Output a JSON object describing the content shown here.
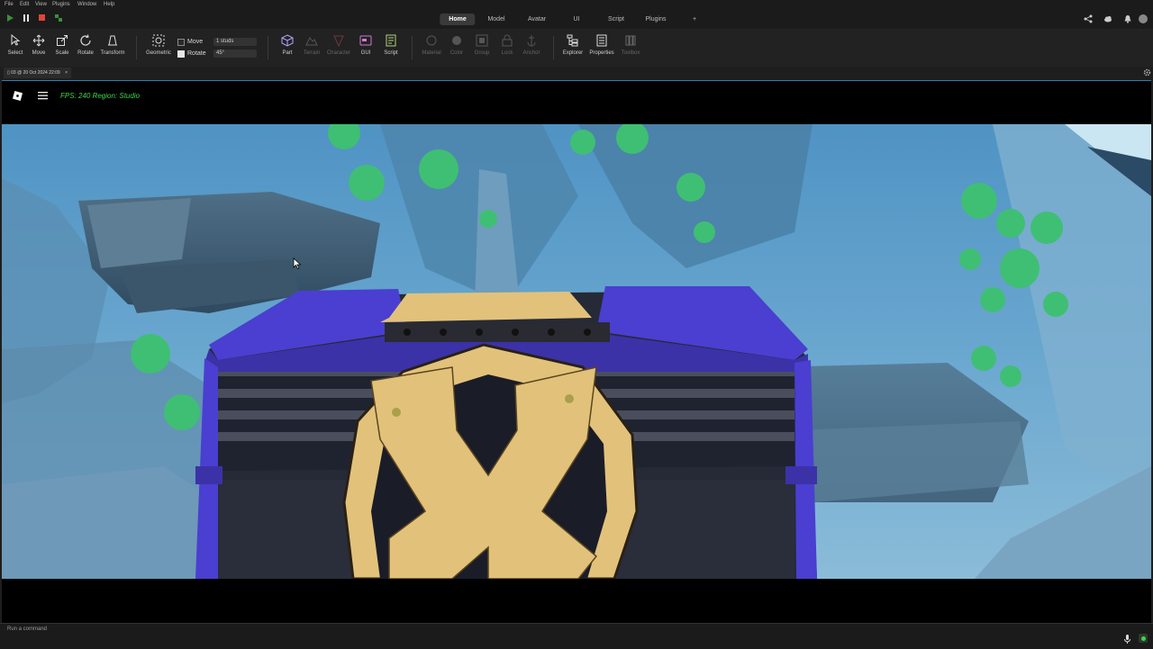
{
  "menu": [
    "File",
    "Edit",
    "View",
    "Plugins",
    "Window",
    "Help"
  ],
  "tabs": [
    {
      "label": "Home",
      "active": true
    },
    {
      "label": "Model",
      "active": false
    },
    {
      "label": "Avatar",
      "active": false
    },
    {
      "label": "UI",
      "active": false
    },
    {
      "label": "Script",
      "active": false
    },
    {
      "label": "Plugins",
      "active": false
    },
    {
      "label": "+",
      "active": false
    }
  ],
  "tools": {
    "select": "Select",
    "move": "Move",
    "scale": "Scale",
    "rotate": "Rotate",
    "transform": "Transform",
    "geometric": "Geometric"
  },
  "snap": {
    "move_label": "Move",
    "move_checked": false,
    "move_value": "1 studs",
    "rotate_label": "Rotate",
    "rotate_checked": true,
    "rotate_value": "45°"
  },
  "insert": {
    "part": "Part",
    "terrain": "Terrain",
    "character": "Character",
    "gui": "GUI",
    "script": "Script"
  },
  "edit": {
    "material": "Material",
    "color": "Color",
    "group": "Group",
    "lock": "Lock",
    "anchor": "Anchor"
  },
  "panels": {
    "explorer": "Explorer",
    "properties": "Properties",
    "toolbox": "Toolbox"
  },
  "file_tab": {
    "label": "03 @ 20 Oct 2024 22:09",
    "close": "×"
  },
  "viewport": {
    "fps_text": "FPS: 240 Region: Studio"
  },
  "command_bar": {
    "placeholder": "Run a command"
  },
  "colors": {
    "accent_blue": "#2d7fb5",
    "fps_green": "#3fd44d",
    "chest_purple": "#4a3fd0",
    "lock_gold": "#e2c27a",
    "water_blue": "#5b9cc8"
  }
}
